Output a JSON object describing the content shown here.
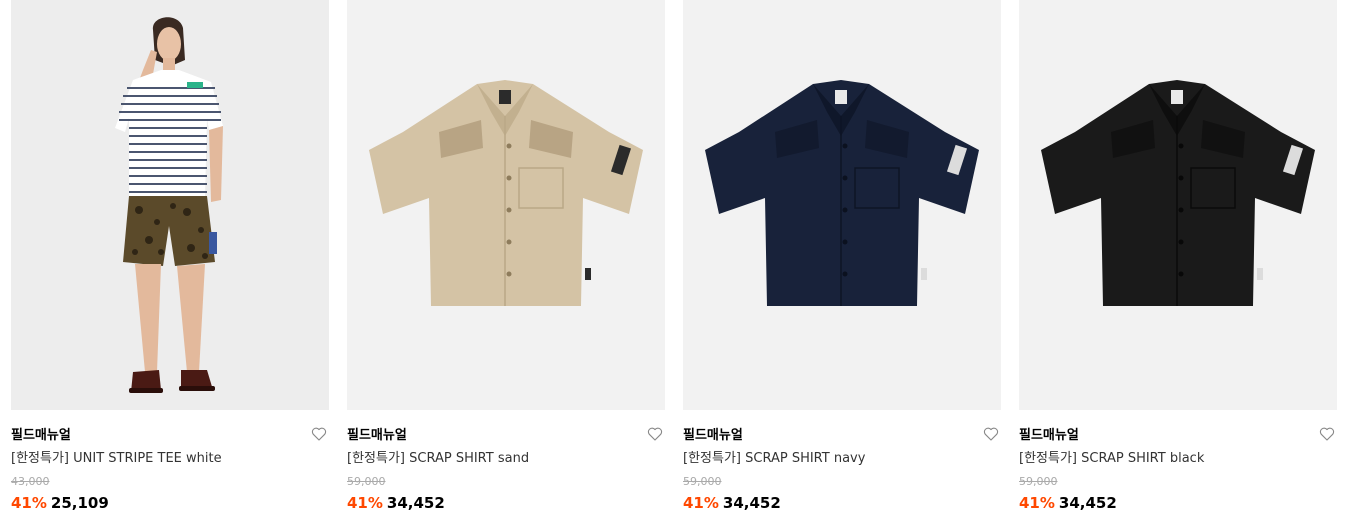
{
  "products": [
    {
      "brand": "필드매뉴얼",
      "name": "[한정특가] UNIT STRIPE TEE white",
      "original_price": "43,000",
      "discount": "41%",
      "sale_price": "25,109",
      "image": "model-striped-tee-photo"
    },
    {
      "brand": "필드매뉴얼",
      "name": "[한정특가] SCRAP SHIRT sand",
      "original_price": "59,000",
      "discount": "41%",
      "sale_price": "34,452",
      "image": "shirt-sand-photo",
      "color": "#d4c3a5"
    },
    {
      "brand": "필드매뉴얼",
      "name": "[한정특가] SCRAP SHIRT navy",
      "original_price": "59,000",
      "discount": "41%",
      "sale_price": "34,452",
      "image": "shirt-navy-photo",
      "color": "#18223a"
    },
    {
      "brand": "필드매뉴얼",
      "name": "[한정특가] SCRAP SHIRT black",
      "original_price": "59,000",
      "discount": "41%",
      "sale_price": "34,452",
      "image": "shirt-black-photo",
      "color": "#1a1a1a"
    }
  ],
  "colors": {
    "discount": "#ff4800",
    "thumb_background": "#f2f2f2",
    "original_price": "#aaaaaa"
  },
  "icons": {
    "wishlist": "heart-outline-icon"
  }
}
